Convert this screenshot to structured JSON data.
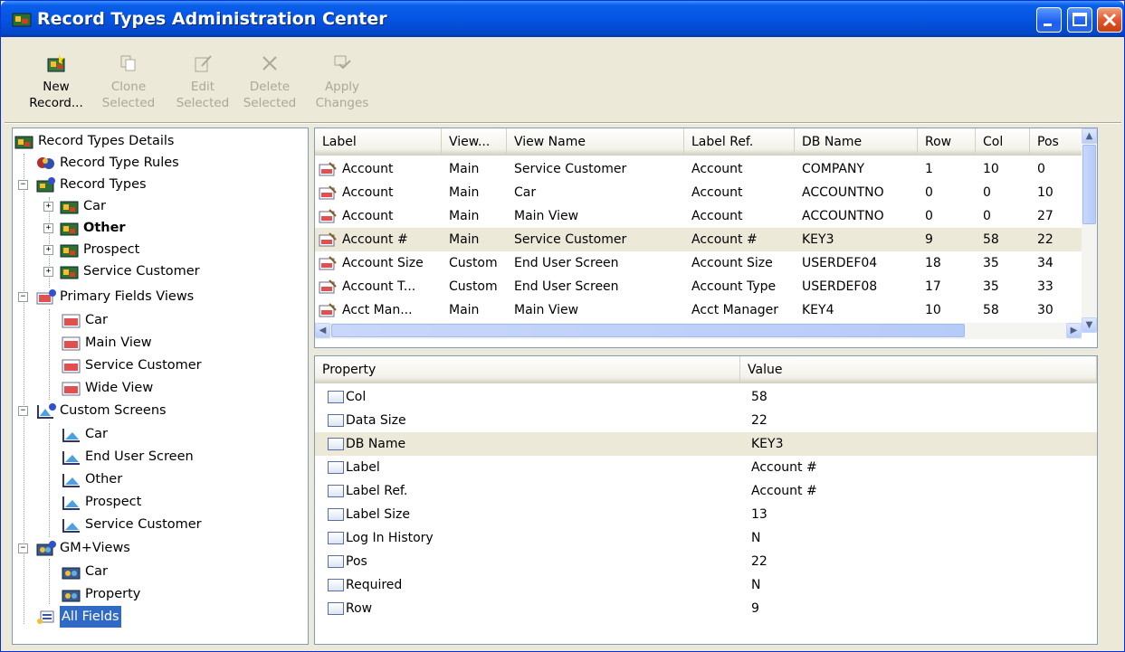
{
  "window": {
    "title": "Record Types Administration Center"
  },
  "toolbar": {
    "new_record": "New\nRecord...",
    "clone_selected": "Clone\nSelected",
    "edit_selected": "Edit\nSelected",
    "delete_selected": "Delete\nSelected",
    "apply_changes": "Apply\nChanges"
  },
  "tree": {
    "root": "Record Types Details",
    "rules": "Record Type Rules",
    "record_types": "Record Types",
    "rt_items": [
      "Car",
      "Other",
      "Prospect",
      "Service Customer"
    ],
    "primary_fields_views": "Primary Fields Views",
    "pfv_items": [
      "Car",
      "Main View",
      "Service Customer",
      "Wide View"
    ],
    "custom_screens": "Custom Screens",
    "cs_items": [
      "Car",
      "End User Screen",
      "Other",
      "Prospect",
      "Service Customer"
    ],
    "gm_views": "GM+Views",
    "gm_items": [
      "Car",
      "Property"
    ],
    "all_fields": "All Fields"
  },
  "grid": {
    "columns": [
      "Label",
      "View...",
      "View Name",
      "Label Ref.",
      "DB Name",
      "Row",
      "Col",
      "Pos"
    ],
    "rows": [
      [
        "Account",
        "Main",
        "Service Customer",
        "Account",
        "COMPANY",
        "1",
        "10",
        "0"
      ],
      [
        "Account",
        "Main",
        "Car",
        "Account",
        "ACCOUNTNO",
        "0",
        "0",
        "10"
      ],
      [
        "Account",
        "Main",
        "Main View",
        "Account",
        "ACCOUNTNO",
        "0",
        "0",
        "27"
      ],
      [
        "Account #",
        "Main",
        "Service Customer",
        "Account #",
        "KEY3",
        "9",
        "58",
        "22"
      ],
      [
        "Account Size",
        "Custom",
        "End User Screen",
        "Account Size",
        "USERDEF04",
        "18",
        "35",
        "34"
      ],
      [
        "Account T...",
        "Custom",
        "End User Screen",
        "Account Type",
        "USERDEF08",
        "17",
        "35",
        "33"
      ],
      [
        "Acct Man...",
        "Main",
        "Main View",
        "Acct Manager",
        "KEY4",
        "10",
        "58",
        "30"
      ]
    ]
  },
  "properties": {
    "header_property": "Property",
    "header_value": "Value",
    "rows": [
      [
        "Col",
        "58"
      ],
      [
        "Data Size",
        "22"
      ],
      [
        "DB Name",
        "KEY3"
      ],
      [
        "Label",
        "Account #"
      ],
      [
        "Label Ref.",
        "Account #"
      ],
      [
        "Label Size",
        "13"
      ],
      [
        "Log In History",
        "N"
      ],
      [
        "Pos",
        "22"
      ],
      [
        "Required",
        "N"
      ],
      [
        "Row",
        "9"
      ]
    ]
  }
}
